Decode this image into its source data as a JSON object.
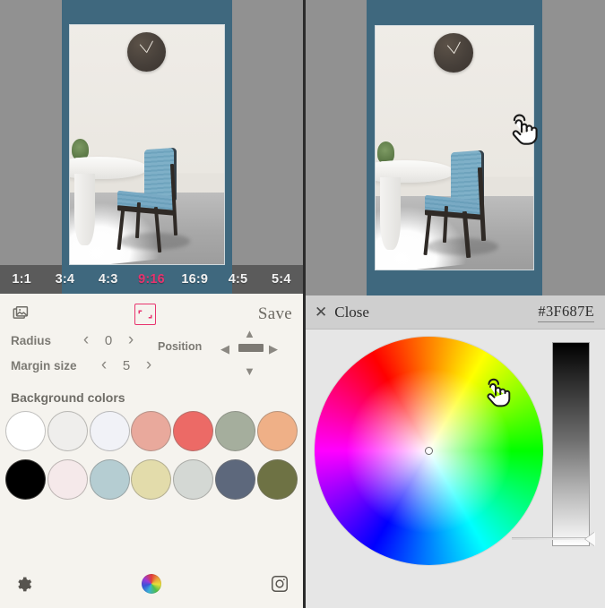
{
  "app": {
    "accent_pink": "#e8336e",
    "canvas_background_color": "#3f687e",
    "stage_surround_color": "#919191",
    "panel_background": "#f5f3ee"
  },
  "left_panel": {
    "preview": {
      "name": "image-preview",
      "background_color": "#3f687e",
      "scene_description": "interior photo: wall clock, round white table with small plant, blue upholstered chair on concrete floor"
    },
    "ratio_bar": {
      "items": [
        {
          "label": "1:1",
          "active": false
        },
        {
          "label": "3:4",
          "active": false
        },
        {
          "label": "4:3",
          "active": false
        },
        {
          "label": "9:16",
          "active": true
        },
        {
          "label": "16:9",
          "active": false
        },
        {
          "label": "4:5",
          "active": false
        },
        {
          "label": "5:4",
          "active": false
        }
      ],
      "active_label": "9:16"
    },
    "toolbar": {
      "gallery_icon": "gallery-icon",
      "expand_icon": "expand-icon",
      "save_label": "Save"
    },
    "controls": {
      "radius_label": "Radius",
      "radius_value": "0",
      "margin_label": "Margin size",
      "margin_value": "5",
      "position_label": "Position",
      "prev_chevron": "‹",
      "next_chevron": "›",
      "arrow_up": "▲",
      "arrow_down": "▼",
      "arrow_left": "◀",
      "arrow_right": "▶"
    },
    "background_colors": {
      "title": "Background colors",
      "row1": [
        {
          "name": "white",
          "hex": "#ffffff"
        },
        {
          "name": "off-white",
          "hex": "#efeeec"
        },
        {
          "name": "lavender-white",
          "hex": "#f1f2f7"
        },
        {
          "name": "salmon-pink",
          "hex": "#e9a99c"
        },
        {
          "name": "coral-red",
          "hex": "#ec6a66"
        },
        {
          "name": "sage-green",
          "hex": "#a5ae9d"
        },
        {
          "name": "peach",
          "hex": "#efb087"
        }
      ],
      "row2": [
        {
          "name": "black",
          "hex": "#000000"
        },
        {
          "name": "blush-pink",
          "hex": "#f5e9ea"
        },
        {
          "name": "pale-blue",
          "hex": "#b5cdd2"
        },
        {
          "name": "cream-yellow",
          "hex": "#e3dcab"
        },
        {
          "name": "light-gray",
          "hex": "#d4d8d4"
        },
        {
          "name": "slate-blue",
          "hex": "#5d687c"
        },
        {
          "name": "olive-green",
          "hex": "#6e7244"
        }
      ]
    },
    "bottom_bar": {
      "settings_icon": "gear-icon",
      "color_wheel_icon": "color-wheel-icon",
      "camera_icon": "camera-icon"
    }
  },
  "right_panel": {
    "header": {
      "close_x": "✕",
      "close_label": "Close",
      "hex_value": "#3F687E"
    },
    "color_picker": {
      "wheel_name": "hue-saturation-wheel",
      "cursor_position": "center",
      "brightness_slider_name": "brightness-slider",
      "brightness_handle_position": "bottom"
    },
    "preview": {
      "name": "image-preview-right",
      "background_color": "#3f687e"
    },
    "cursor_hint": "tap-hand-cursor"
  }
}
